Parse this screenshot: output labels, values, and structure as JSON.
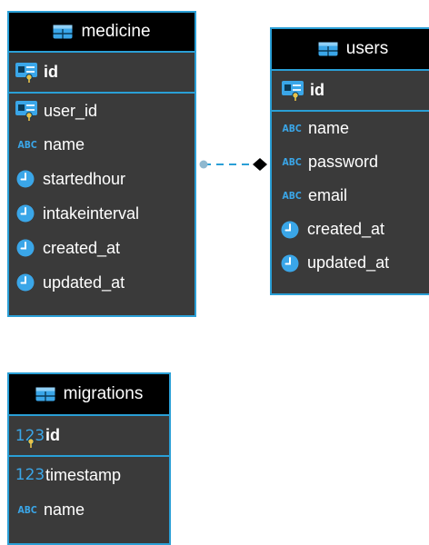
{
  "colors": {
    "border": "#2a9fd6",
    "header_bg": "#000000",
    "body_bg": "#3a3a3a",
    "icon_blue": "#3aa6e8"
  },
  "entities": {
    "medicine": {
      "title": "medicine",
      "pk": "id",
      "columns": [
        {
          "name": "user_id",
          "type": "key-icon"
        },
        {
          "name": "name",
          "type": "abc-icon"
        },
        {
          "name": "startedhour",
          "type": "clock-icon"
        },
        {
          "name": "intakeinterval",
          "type": "clock-icon"
        },
        {
          "name": "created_at",
          "type": "clock-icon"
        },
        {
          "name": "updated_at",
          "type": "clock-icon"
        }
      ]
    },
    "users": {
      "title": "users",
      "pk": "id",
      "columns": [
        {
          "name": "name",
          "type": "abc-icon"
        },
        {
          "name": "password",
          "type": "abc-icon"
        },
        {
          "name": "email",
          "type": "abc-icon"
        },
        {
          "name": "created_at",
          "type": "clock-icon"
        },
        {
          "name": "updated_at",
          "type": "clock-icon"
        }
      ]
    },
    "migrations": {
      "title": "migrations",
      "pk": "id",
      "columns": [
        {
          "name": "timestamp",
          "type": "number-icon"
        },
        {
          "name": "name",
          "type": "abc-icon"
        }
      ]
    }
  },
  "icon_text": {
    "abc": "ABC",
    "num": "123"
  },
  "relationship": {
    "from": "medicine",
    "to": "users",
    "style": "dashed"
  }
}
